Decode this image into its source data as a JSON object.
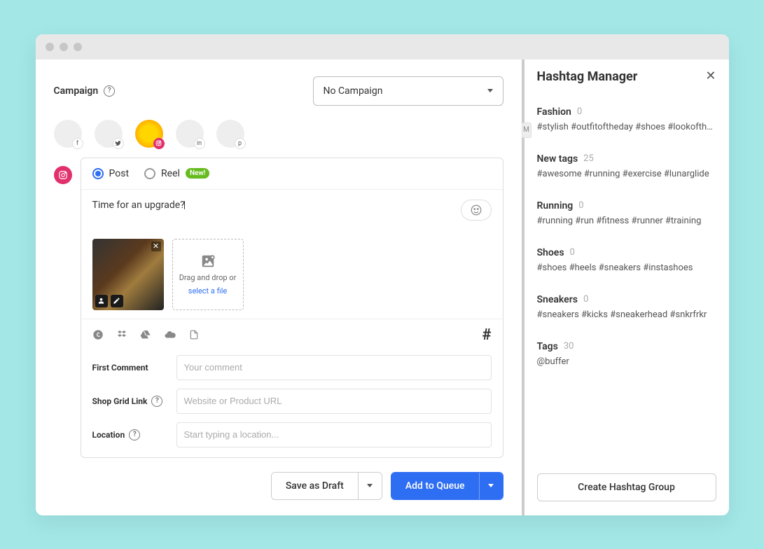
{
  "header": {
    "campaign_label": "Campaign",
    "campaign_dropdown_value": "No Campaign"
  },
  "accounts": [
    {
      "network": "facebook",
      "selected": false
    },
    {
      "network": "twitter",
      "selected": false
    },
    {
      "network": "instagram",
      "selected": true
    },
    {
      "network": "linkedin",
      "selected": false
    },
    {
      "network": "pinterest",
      "selected": false
    }
  ],
  "composer": {
    "active_network": "instagram",
    "post_type_post": "Post",
    "post_type_reel": "Reel",
    "reel_badge": "New!",
    "text": "Time for an upgrade?",
    "dropzone_line1": "Drag and drop or",
    "dropzone_link": "select a file",
    "first_comment_label": "First Comment",
    "first_comment_placeholder": "Your comment",
    "shop_link_label": "Shop Grid Link",
    "shop_link_placeholder": "Website or Product URL",
    "location_label": "Location",
    "location_placeholder": "Start typing a location..."
  },
  "actions": {
    "draft": "Save as Draft",
    "queue": "Add to Queue"
  },
  "sidebar": {
    "title": "Hashtag Manager",
    "create_button": "Create Hashtag Group",
    "groups": [
      {
        "name": "Fashion",
        "count": "0",
        "tags": "#stylish #outfitoftheday #shoes #lookoftheday"
      },
      {
        "name": "New tags",
        "count": "25",
        "tags": "#awesome #running #exercise #lunarglide"
      },
      {
        "name": "Running",
        "count": "0",
        "tags": "#running #run #fitness #runner #training"
      },
      {
        "name": "Shoes",
        "count": "0",
        "tags": "#shoes #heels #sneakers #instashoes"
      },
      {
        "name": "Sneakers",
        "count": "0",
        "tags": "#sneakers #kicks #sneakerhead #snkrfrkr"
      },
      {
        "name": "Tags",
        "count": "30",
        "tags": "@buffer"
      }
    ]
  }
}
